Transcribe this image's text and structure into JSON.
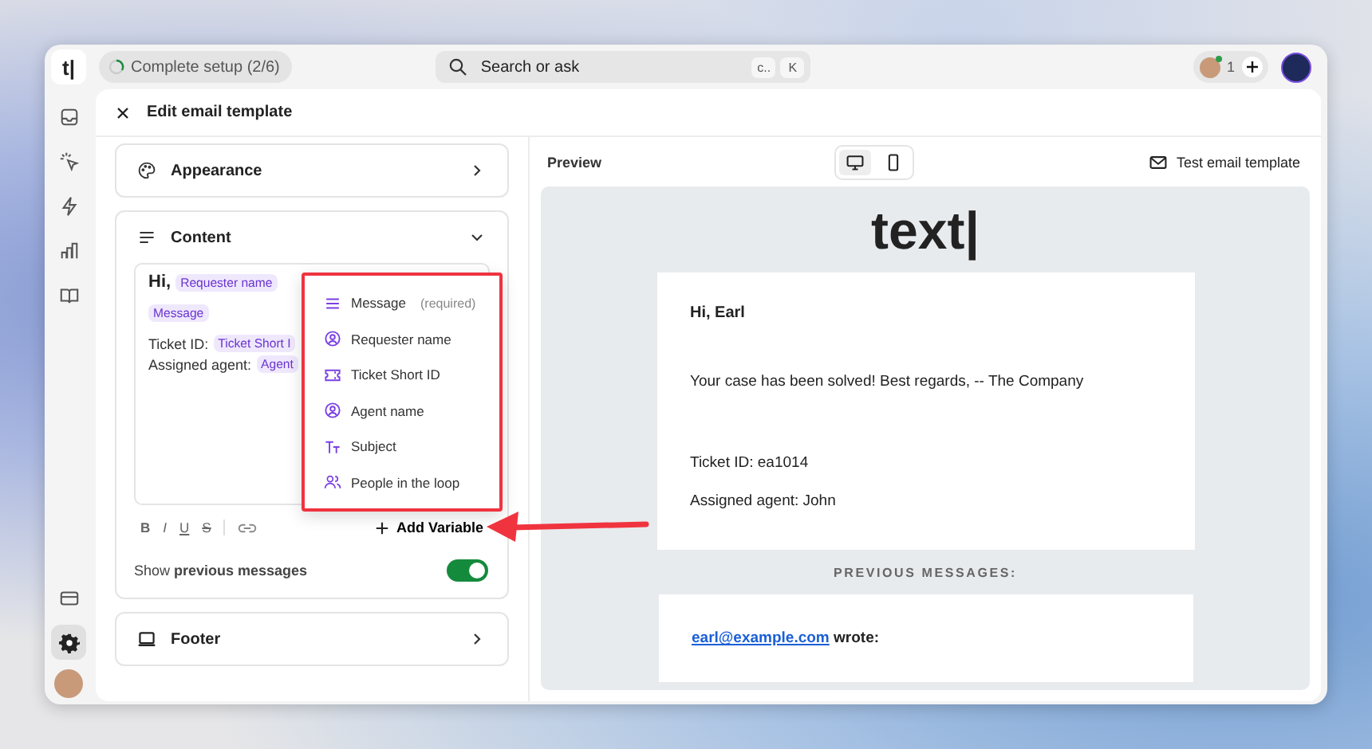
{
  "topbar": {
    "logo": "t|",
    "setup": {
      "label": "Complete setup (2/6)"
    },
    "search": {
      "placeholder": "Search or ask",
      "keys": [
        "c..",
        "K"
      ]
    },
    "collaborators": {
      "count": "1"
    }
  },
  "rail": {
    "items": [
      {
        "kind": "inbox",
        "selected": false
      },
      {
        "kind": "sparkle",
        "selected": false
      },
      {
        "kind": "bolt",
        "selected": false
      },
      {
        "kind": "chart",
        "selected": false
      },
      {
        "kind": "book",
        "selected": false
      }
    ],
    "bottom": [
      {
        "kind": "card",
        "selected": false
      },
      {
        "kind": "gear",
        "selected": true
      }
    ]
  },
  "panel": {
    "title": "Edit email template"
  },
  "sections": [
    {
      "kind": "appearance",
      "label": "Appearance",
      "expanded": false
    },
    {
      "kind": "content",
      "label": "Content",
      "expanded": true
    },
    {
      "kind": "footer",
      "label": "Footer",
      "expanded": false
    }
  ],
  "editor": {
    "lines": [
      [
        {
          "kind": "greeting",
          "text": "Hi,"
        },
        {
          "kind": "chip",
          "text": "Requester name"
        }
      ],
      [
        {
          "kind": "chip",
          "text": "Message"
        }
      ],
      [
        {
          "kind": "text",
          "text": "Ticket ID:"
        },
        {
          "kind": "chip",
          "text": "Ticket Short I"
        }
      ],
      [
        {
          "kind": "text",
          "text": "Assigned agent:"
        },
        {
          "kind": "chip",
          "text": "Agent"
        }
      ]
    ],
    "format_buttons": [
      {
        "kind": "bold",
        "label": "B"
      },
      {
        "kind": "italic",
        "label": "I"
      },
      {
        "kind": "underline",
        "label": "U"
      },
      {
        "kind": "strike",
        "label": "S"
      }
    ],
    "add_variable": "Add Variable"
  },
  "show_previous": {
    "label": "Show **previous messages**",
    "on": true
  },
  "menu": {
    "items": [
      {
        "kind": "lines",
        "label": "Message",
        "note": "(required)"
      },
      {
        "kind": "person",
        "label": "Requester name"
      },
      {
        "kind": "ticket",
        "label": "Ticket Short ID"
      },
      {
        "kind": "person",
        "label": "Agent name"
      },
      {
        "kind": "type",
        "label": "Subject"
      },
      {
        "kind": "people",
        "label": "People in the loop"
      }
    ]
  },
  "preview": {
    "label": "Preview",
    "devices": [
      {
        "kind": "desktop",
        "selected": true
      },
      {
        "kind": "mobile",
        "selected": false
      }
    ],
    "test_button": "Test email template",
    "logo": "text|",
    "email": {
      "greeting": "Hi, Earl",
      "body": "Your case has been solved! Best regards, -- The Company",
      "lines": [
        "Ticket ID: ea1014",
        "Assigned agent: John"
      ]
    },
    "previous_heading": "PREVIOUS MESSAGES:",
    "previous": {
      "link": "earl@example.com",
      "suffix": "wrote:"
    }
  }
}
